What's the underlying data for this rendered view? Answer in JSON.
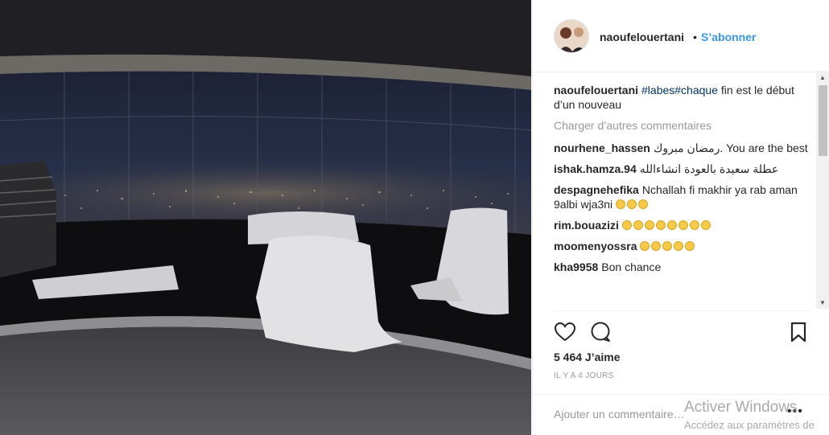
{
  "post": {
    "username": "naoufelouertani",
    "separator": "•",
    "follow_label": "S’abonner",
    "caption_user": "naoufelouertani",
    "caption_tags": "#labes#chaque",
    "caption_text": " fin est le début d’un nouveau",
    "load_more_label": "Charger d’autres commentaires",
    "likes": "5 464 J’aime",
    "timestamp": "IL Y A 4 JOURS",
    "add_comment_placeholder": "Ajouter un commentaire…",
    "more_options": "•••"
  },
  "comments": [
    {
      "user": "nourhene_hassen",
      "text": "رمضان مبروك. You are the best",
      "emoji_count": 0
    },
    {
      "user": "ishak.hamza.94",
      "text": "عطلة سعيدة بالعودة انشاءالله",
      "emoji_count": 0
    },
    {
      "user": "despagnehefika",
      "text": "Nchallah fi makhir ya rab aman 9albi wja3ni",
      "emoji_count": 3
    },
    {
      "user": "rim.bouazizi",
      "text": "",
      "emoji_count": 8
    },
    {
      "user": "moomenyossra",
      "text": "",
      "emoji_count": 5
    },
    {
      "user": "kha9958",
      "text": "Bon chance",
      "emoji_count": 0
    }
  ],
  "icons": {
    "like": "heart-icon",
    "comment": "comment-bubble-icon",
    "save": "bookmark-icon"
  },
  "watermark": {
    "title": "Activer Windows",
    "subtitle": "Accédez aux paramètres de"
  },
  "colors": {
    "link_blue": "#3897f0",
    "hashtag": "#003569",
    "muted": "#999999"
  }
}
